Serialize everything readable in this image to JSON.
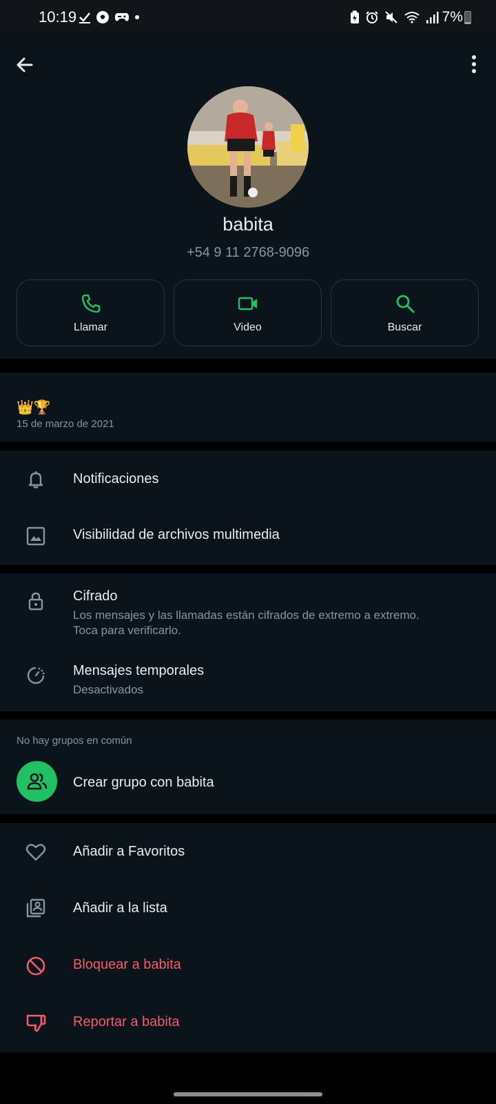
{
  "status_bar": {
    "time": "10:19",
    "battery": "7%",
    "left_icons": [
      "check-icon",
      "soccer-ball-icon",
      "game-controller-icon",
      "dot-icon"
    ],
    "right_icons": [
      "battery-saver-icon",
      "alarm-icon",
      "mute-icon",
      "wifi-icon",
      "signal-icon"
    ]
  },
  "header": {
    "back_icon": "arrow-left-icon",
    "menu_icon": "more-vertical-icon"
  },
  "contact": {
    "name": "babita",
    "phone": "+54 9 11 2768-9096"
  },
  "actions": [
    {
      "label": "Llamar",
      "icon": "phone-icon"
    },
    {
      "label": "Video",
      "icon": "video-icon"
    },
    {
      "label": "Buscar",
      "icon": "search-icon"
    }
  ],
  "about": {
    "status": "👑🏆",
    "date": "15 de marzo de 2021"
  },
  "settings": [
    {
      "title": "Notificaciones",
      "icon": "bell-icon"
    },
    {
      "title": "Visibilidad de archivos multimedia",
      "icon": "image-icon"
    }
  ],
  "privacy": {
    "encryption_title": "Cifrado",
    "encryption_sub_1": "Los mensajes y las llamadas están cifrados de extremo a extremo.",
    "encryption_sub_2": "Toca para verificarlo.",
    "disappearing_title": "Mensajes temporales",
    "disappearing_sub": "Desactivados"
  },
  "groups": {
    "label": "No hay grupos en común",
    "create": "Crear grupo con babita"
  },
  "bottom_actions": [
    {
      "label": "Añadir a Favoritos",
      "icon": "heart-icon"
    },
    {
      "label": "Añadir a la lista",
      "icon": "contact-list-icon"
    },
    {
      "label": "Bloquear a babita",
      "icon": "block-icon"
    },
    {
      "label": "Reportar a babita",
      "icon": "thumbs-down-icon"
    }
  ],
  "colors": {
    "accent": "#21c063",
    "danger": "#f15c6d",
    "background": "#0b141a"
  }
}
